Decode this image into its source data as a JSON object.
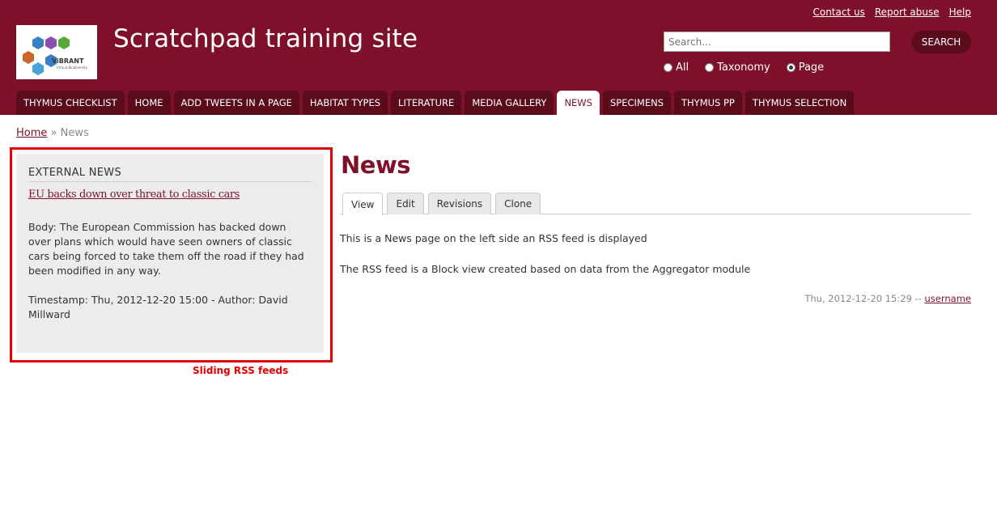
{
  "header": {
    "site_title": "Scratchpad training site",
    "top_links": [
      "Contact us",
      "Report abuse",
      "Help"
    ],
    "logo_text": "ViBRANT",
    "logo_subtext": "Virtual Biodiversity"
  },
  "search": {
    "placeholder": "Search...",
    "button_label": "SEARCH",
    "options": [
      {
        "label": "All",
        "checked": false
      },
      {
        "label": "Taxonomy",
        "checked": false
      },
      {
        "label": "Page",
        "checked": true
      }
    ]
  },
  "nav": {
    "tabs": [
      "THYMUS CHECKLIST",
      "HOME",
      "ADD TWEETS IN A PAGE",
      "HABITAT TYPES",
      "LITERATURE",
      "MEDIA GALLERY",
      "NEWS",
      "SPECIMENS",
      "THYMUS PP",
      "THYMUS SELECTION"
    ],
    "active": "NEWS"
  },
  "breadcrumb": {
    "home": "Home",
    "separator": "»",
    "current": "News"
  },
  "sidebar_block": {
    "title": "EXTERNAL NEWS",
    "link": "EU backs down over threat to classic cars",
    "body": "Body: The European Commission has backed down over plans which would have seen owners of classic cars being forced to take them off the road if they had been modified in any way.",
    "timestamp": "Timestamp: Thu, 2012-12-20 15:00 - Author: David Millward"
  },
  "annotation": {
    "label": "Sliding RSS feeds",
    "color": "#e20000"
  },
  "main": {
    "title": "News",
    "tabs": [
      "View",
      "Edit",
      "Revisions",
      "Clone"
    ],
    "active_tab": "View",
    "paragraphs": [
      "This is a News page on the left side an RSS feed is displayed",
      "The RSS feed is a Block view created based on data from the Aggregator module"
    ],
    "submitted_date": "Thu, 2012-12-20 15:29 --",
    "submitted_user": "username"
  },
  "colors": {
    "brand": "#7e1129",
    "tab_bg": "#5a0c1d"
  }
}
